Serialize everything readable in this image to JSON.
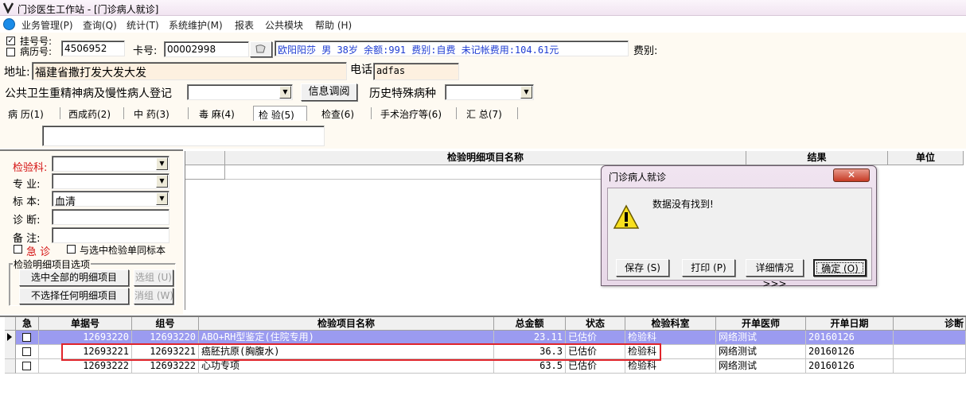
{
  "window": {
    "title": "门诊医生工作站 - [门诊病人就诊]"
  },
  "menu": [
    "业务管理(P)",
    "查询(Q)",
    "统计(T)",
    "系统维护(M)",
    "报表",
    "公共模块",
    "帮助 (H)"
  ],
  "patient": {
    "reg_label": "挂号号:",
    "record_label": "病历号:",
    "reg_no": "4506952",
    "card_label": "卡号:",
    "card_no": "00002998",
    "info": "欧阳阳莎 男 38岁 余额:991 费别:自费 未记帐费用:104.61元",
    "fee_type_label": "费别:",
    "address_label": "地址:",
    "address": "福建省撒打发大发大发",
    "phone_label": "电话",
    "phone": "adfas",
    "chronic_label": "公共卫生重精神病及慢性病人登记",
    "info_query_button": "信息调阅",
    "special_disease_label": "历史特殊病种"
  },
  "tabs": [
    "病 历(1)",
    "西成药(2)",
    "中 药(3)",
    "毒 麻(4)",
    "检 验(5)",
    "检查(6)",
    "手术治疗等(6)",
    "汇 总(7)"
  ],
  "lab_form": {
    "dept_label": "检验科:",
    "major_label": "专  业:",
    "specimen_label": "标  本:",
    "specimen_value": "血清",
    "diagnosis_label": "诊  断:",
    "note_label": "备  注:",
    "urgent_label": "急 诊",
    "same_specimen_label": "与选中检验单同标本",
    "detail_group_title": "检验明细项目选项",
    "select_all_button": "选中全部的明细项目",
    "select_group_button": "选组 (U)",
    "select_none_button": "不选择任何明细项目",
    "cancel_group_button": "消组 (W)"
  },
  "detail_grid": {
    "headers": [
      "检验明细项目名称",
      "结果",
      "单位"
    ]
  },
  "orders": {
    "headers": [
      "急",
      "单据号",
      "组号",
      "检验项目名称",
      "总金额",
      "状态",
      "检验科室",
      "开单医师",
      "开单日期",
      "诊断"
    ],
    "rows": [
      {
        "doc_no": "12693220",
        "group_no": "12693220",
        "name": "ABO+RH型鉴定(住院专用)",
        "amount": "23.11",
        "status": "已估价",
        "dept": "检验科",
        "doctor": "网络测试",
        "date": "20160126"
      },
      {
        "doc_no": "12693221",
        "group_no": "12693221",
        "name": "癌胚抗原(胸腹水)",
        "amount": "36.3",
        "status": "已估价",
        "dept": "检验科",
        "doctor": "网络测试",
        "date": "20160126"
      },
      {
        "doc_no": "12693222",
        "group_no": "12693222",
        "name": "心功专项",
        "amount": "63.5",
        "status": "已估价",
        "dept": "检验科",
        "doctor": "网络测试",
        "date": "20160126"
      }
    ]
  },
  "dialog": {
    "title": "门诊病人就诊",
    "message": "数据没有找到!",
    "save_button": "保存 (S)",
    "print_button": "打印 (P)",
    "details_button": "详细情况>>>",
    "ok_button": "确定 (O)"
  },
  "colors": {
    "selected_row": "#9b9bf0",
    "highlight_box": "#e0242b",
    "info_text": "#1e3cd2",
    "address_bg": "#fdf0e0"
  }
}
